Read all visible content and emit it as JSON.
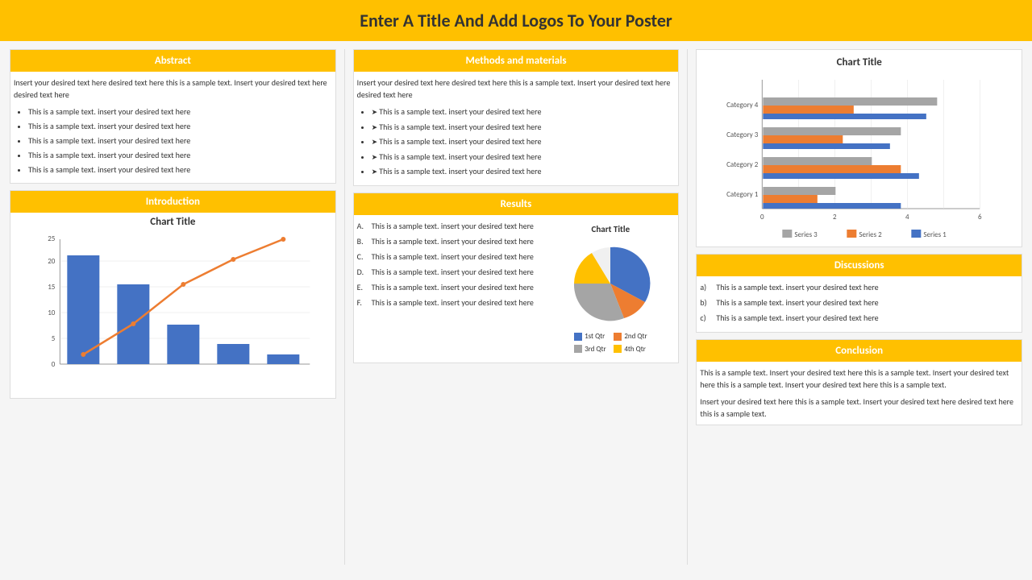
{
  "header": {
    "title": "Enter A Title And Add Logos To Your Poster"
  },
  "abstract": {
    "heading": "Abstract",
    "intro": "Insert your desired text here desired text here this is a sample text. Insert your desired text here desired text here",
    "bullets": [
      "This is a sample text. insert your desired text here",
      "This is a sample text. insert your desired text here",
      "This is a sample text. insert your desired text here",
      "This is a sample text. insert your desired text here",
      "This is a sample text. insert your desired text here"
    ]
  },
  "methods": {
    "heading": "Methods and materials",
    "intro": "Insert your desired text here desired text here this is a sample text. Insert your desired text here desired text here",
    "bullets": [
      "This is a sample text. insert your desired text here",
      "This is a sample text. insert your desired text here",
      "This is a sample text. insert your desired text here",
      "This is a sample text. insert your desired text here",
      "This is a sample text. insert your desired text here"
    ]
  },
  "introduction": {
    "heading": "Introduction",
    "chart_title": "Chart Title",
    "bar_data": [
      22,
      16,
      8,
      4,
      2
    ],
    "line_data": [
      2,
      8,
      16,
      21,
      25
    ],
    "y_labels": [
      "0",
      "5",
      "10",
      "15",
      "20",
      "25"
    ],
    "x_labels": [
      "",
      "",
      "",
      "",
      ""
    ]
  },
  "results": {
    "heading": "Results",
    "items": [
      {
        "label": "A.",
        "text": "This is a sample text. insert your desired text here"
      },
      {
        "label": "B.",
        "text": "This is a sample text. insert your desired text here"
      },
      {
        "label": "C.",
        "text": "This is a sample text. insert your desired text here"
      },
      {
        "label": "D.",
        "text": "This is a sample text. insert your desired text here"
      },
      {
        "label": "E.",
        "text": "This is a sample text. insert your desired text here"
      },
      {
        "label": "F.",
        "text": "This is a sample text. insert your desired text here"
      }
    ],
    "chart_title": "Chart Title",
    "pie_segments": [
      {
        "label": "1st Qtr",
        "color": "#4472C4",
        "value": 30
      },
      {
        "label": "2nd Qtr",
        "color": "#ED7D31",
        "value": 15
      },
      {
        "label": "3rd Qtr",
        "color": "#A5A5A5",
        "value": 20
      },
      {
        "label": "4th Qtr",
        "color": "#FFC000",
        "value": 10
      }
    ]
  },
  "chart_top_right": {
    "title": "Chart Title",
    "categories": [
      "Category 4",
      "Category 3",
      "Category 2",
      "Category 1"
    ],
    "series": [
      {
        "name": "Series 1",
        "color": "#4472C4",
        "values": [
          4.5,
          3.5,
          4.3,
          3.8
        ]
      },
      {
        "name": "Series 2",
        "color": "#ED7D31",
        "values": [
          2.5,
          2.2,
          3.8,
          1.5
        ]
      },
      {
        "name": "Series 3",
        "color": "#A5A5A5",
        "values": [
          4.8,
          3.8,
          3.0,
          2.0
        ]
      }
    ],
    "x_labels": [
      "0",
      "2",
      "4",
      "6"
    ],
    "max_value": 6
  },
  "discussions": {
    "heading": "Discussions",
    "items": [
      {
        "label": "a)",
        "text": "This is a sample text. insert your desired text here"
      },
      {
        "label": "b)",
        "text": "This is a sample text. insert your desired text here"
      },
      {
        "label": "c)",
        "text": "This is a sample text. insert your desired text here"
      }
    ]
  },
  "conclusion": {
    "heading": "Conclusion",
    "paragraph1": "This is a sample text. Insert your desired text here this is a sample text. Insert your desired text here this is a sample text. Insert your desired text here this is a sample text.",
    "paragraph2": "Insert your desired text here this is a sample text. Insert your desired text here desired text here this is a sample text."
  }
}
